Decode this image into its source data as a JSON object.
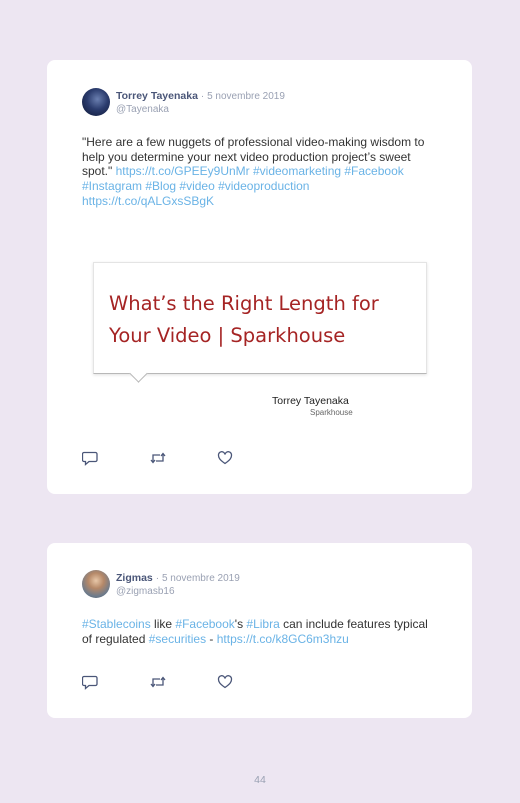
{
  "tweets": [
    {
      "name": "Torrey Tayenaka",
      "separator": "·",
      "date": "5 novembre 2019",
      "handle": "@Tayenaka",
      "text": [
        {
          "t": "\"Here are a few nuggets of professional video-making wisdom to help you determine your next video production project’s sweet spot.\" ",
          "link": false
        },
        {
          "t": "https://t.co/GPEEy9UnMr #videomarketing #Facebook #Instagram #Blog #video #videoproduction https://t.co/qALGxsSBgK",
          "link": true
        }
      ],
      "card": {
        "title": "What’s the Right Length for Your Video | Sparkhouse",
        "author": "Torrey Tayenaka",
        "org": "Sparkhouse"
      }
    },
    {
      "name": "Zigmas",
      "separator": "·",
      "date": "5 novembre 2019",
      "handle": "@zigmasb16",
      "text": [
        {
          "t": "#Stablecoins",
          "link": true
        },
        {
          "t": " like ",
          "link": false
        },
        {
          "t": "#Facebook",
          "link": true
        },
        {
          "t": "'s ",
          "link": false
        },
        {
          "t": "#Libra",
          "link": true
        },
        {
          "t": " can include features typical of regulated ",
          "link": false
        },
        {
          "t": "#securities",
          "link": true
        },
        {
          "t": " - ",
          "link": false
        },
        {
          "t": "https://t.co/k8GC6m3hzu",
          "link": true
        }
      ]
    }
  ],
  "icons": {
    "reply": "reply-icon",
    "retweet": "retweet-icon",
    "like": "heart-icon"
  },
  "colors": {
    "background": "#ede6f2",
    "link": "#6ab3e6",
    "name": "#4a5678",
    "card_title": "#a52424"
  },
  "page_number": "44"
}
